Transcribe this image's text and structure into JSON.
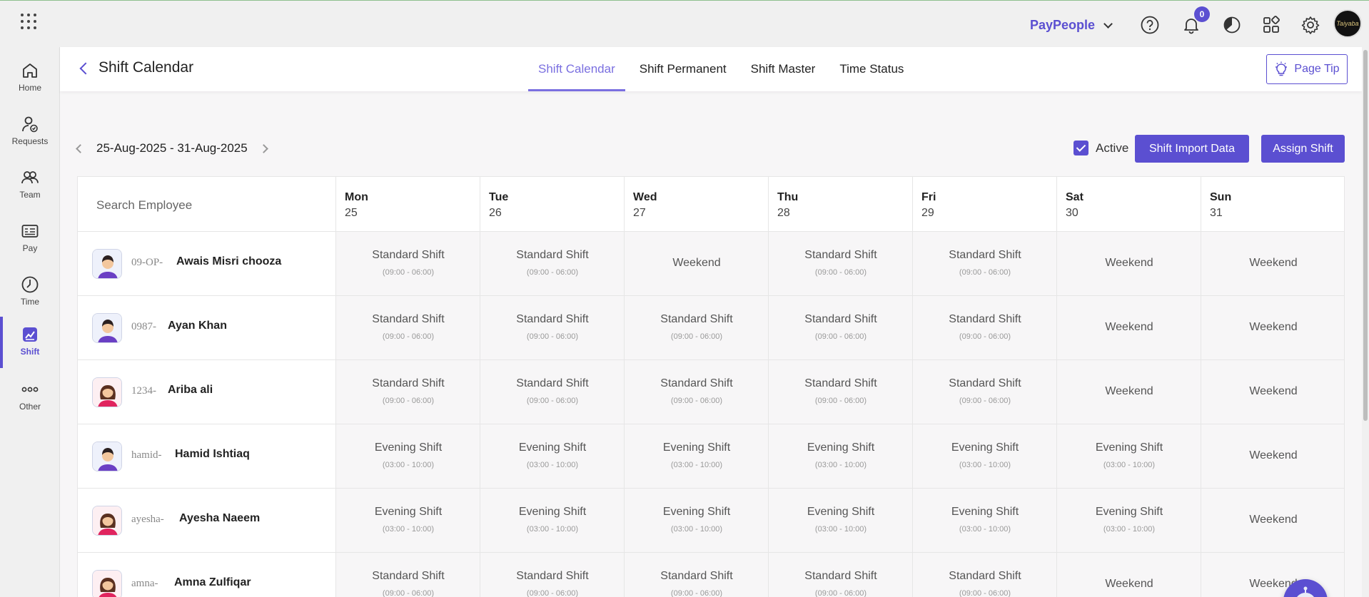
{
  "topbar": {
    "brand": "PayPeople",
    "notification_count": "0",
    "profile_logo": "Taiyaba"
  },
  "sidebar": {
    "items": [
      {
        "label": "Home",
        "icon": "home-icon"
      },
      {
        "label": "Requests",
        "icon": "requests-icon"
      },
      {
        "label": "Team",
        "icon": "team-icon"
      },
      {
        "label": "Pay",
        "icon": "pay-icon"
      },
      {
        "label": "Time",
        "icon": "clock-icon"
      },
      {
        "label": "Shift",
        "icon": "shift-icon",
        "active": true
      },
      {
        "label": "Other",
        "icon": "more-icon"
      }
    ]
  },
  "header": {
    "title": "Shift Calendar",
    "tabs": [
      "Shift Calendar",
      "Shift Permanent",
      "Shift Master",
      "Time Status"
    ],
    "active_tab": "Shift Calendar",
    "page_tip": "Page Tip"
  },
  "toolbar": {
    "week_range": "25-Aug-2025 - 31-Aug-2025",
    "active_label": "Active",
    "active_checked": true,
    "import_button": "Shift Import Data",
    "assign_button": "Assign Shift"
  },
  "calendar": {
    "search_placeholder": "Search Employee",
    "days": [
      {
        "name": "Mon",
        "date": "25"
      },
      {
        "name": "Tue",
        "date": "26"
      },
      {
        "name": "Wed",
        "date": "27"
      },
      {
        "name": "Thu",
        "date": "28"
      },
      {
        "name": "Fri",
        "date": "29"
      },
      {
        "name": "Sat",
        "date": "30"
      },
      {
        "name": "Sun",
        "date": "31"
      }
    ],
    "employees": [
      {
        "code": "09-OP-",
        "name": "Awais Misri chooza",
        "gender": "male",
        "shifts": [
          [
            "Standard Shift",
            "(09:00 - 06:00)"
          ],
          [
            "Standard Shift",
            "(09:00 - 06:00)"
          ],
          [
            "Weekend",
            ""
          ],
          [
            "Standard Shift",
            "(09:00 - 06:00)"
          ],
          [
            "Standard Shift",
            "(09:00 - 06:00)"
          ],
          [
            "Weekend",
            ""
          ],
          [
            "Weekend",
            ""
          ]
        ]
      },
      {
        "code": "0987-",
        "name": "Ayan Khan",
        "gender": "male",
        "shifts": [
          [
            "Standard Shift",
            "(09:00 - 06:00)"
          ],
          [
            "Standard Shift",
            "(09:00 - 06:00)"
          ],
          [
            "Standard Shift",
            "(09:00 - 06:00)"
          ],
          [
            "Standard Shift",
            "(09:00 - 06:00)"
          ],
          [
            "Standard Shift",
            "(09:00 - 06:00)"
          ],
          [
            "Weekend",
            ""
          ],
          [
            "Weekend",
            ""
          ]
        ]
      },
      {
        "code": "1234-",
        "name": "Ariba ali",
        "gender": "female",
        "shifts": [
          [
            "Standard Shift",
            "(09:00 - 06:00)"
          ],
          [
            "Standard Shift",
            "(09:00 - 06:00)"
          ],
          [
            "Standard Shift",
            "(09:00 - 06:00)"
          ],
          [
            "Standard Shift",
            "(09:00 - 06:00)"
          ],
          [
            "Standard Shift",
            "(09:00 - 06:00)"
          ],
          [
            "Weekend",
            ""
          ],
          [
            "Weekend",
            ""
          ]
        ]
      },
      {
        "code": "hamid-",
        "name": "Hamid Ishtiaq",
        "gender": "male",
        "shifts": [
          [
            "Evening Shift",
            "(03:00 - 10:00)"
          ],
          [
            "Evening Shift",
            "(03:00 - 10:00)"
          ],
          [
            "Evening Shift",
            "(03:00 - 10:00)"
          ],
          [
            "Evening Shift",
            "(03:00 - 10:00)"
          ],
          [
            "Evening Shift",
            "(03:00 - 10:00)"
          ],
          [
            "Evening Shift",
            "(03:00 - 10:00)"
          ],
          [
            "Weekend",
            ""
          ]
        ]
      },
      {
        "code": "ayesha-",
        "name": "Ayesha Naeem",
        "gender": "female",
        "shifts": [
          [
            "Evening Shift",
            "(03:00 - 10:00)"
          ],
          [
            "Evening Shift",
            "(03:00 - 10:00)"
          ],
          [
            "Evening Shift",
            "(03:00 - 10:00)"
          ],
          [
            "Evening Shift",
            "(03:00 - 10:00)"
          ],
          [
            "Evening Shift",
            "(03:00 - 10:00)"
          ],
          [
            "Evening Shift",
            "(03:00 - 10:00)"
          ],
          [
            "Weekend",
            ""
          ]
        ]
      },
      {
        "code": "amna-",
        "name": "Amna Zulfiqar",
        "gender": "female",
        "shifts": [
          [
            "Standard Shift",
            "(09:00 - 06:00)"
          ],
          [
            "Standard Shift",
            "(09:00 - 06:00)"
          ],
          [
            "Standard Shift",
            "(09:00 - 06:00)"
          ],
          [
            "Standard Shift",
            "(09:00 - 06:00)"
          ],
          [
            "Standard Shift",
            "(09:00 - 06:00)"
          ],
          [
            "Weekend",
            ""
          ],
          [
            "Weekend",
            ""
          ]
        ]
      }
    ]
  },
  "colors": {
    "accent": "#5b4fd1",
    "tab_active": "#7a6fe0"
  }
}
